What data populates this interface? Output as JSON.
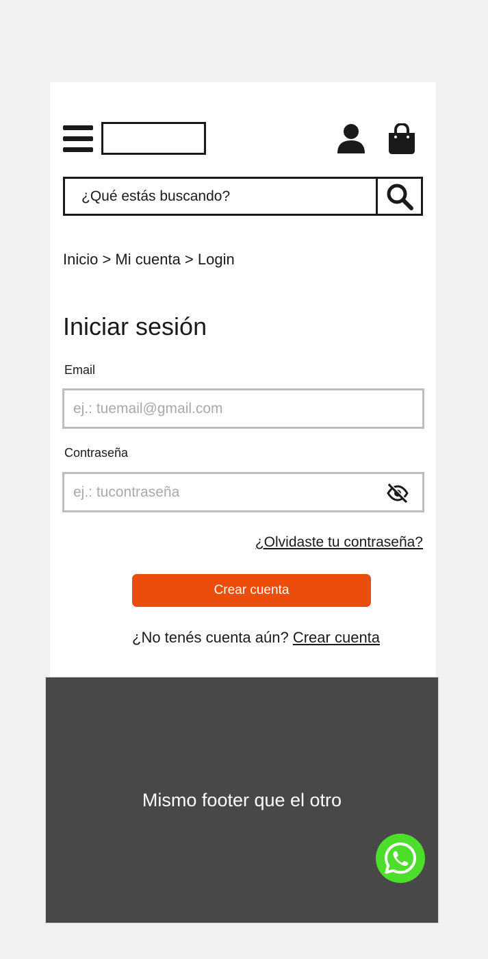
{
  "header": {
    "menu_icon": "hamburger-icon",
    "user_icon": "user-icon",
    "cart_icon": "shopping-bag-icon"
  },
  "search": {
    "placeholder": "¿Qué estás buscando?",
    "icon": "search-icon"
  },
  "breadcrumb": "Inicio > Mi cuenta > Login",
  "login": {
    "title": "Iniciar sesión",
    "email_label": "Email",
    "email_placeholder": "ej.: tuemail@gmail.com",
    "password_label": "Contraseña",
    "password_placeholder": "ej.: tucontraseña",
    "password_toggle_icon": "eye-slash-icon",
    "forgot_link": "¿Olvidaste tu contraseña?",
    "submit_label": "Crear cuenta",
    "no_account_text": "¿No tenés cuenta aún?",
    "signup_link": "Crear cuenta"
  },
  "footer": {
    "text": "Mismo footer que el otro"
  },
  "whatsapp": {
    "icon": "whatsapp-icon"
  },
  "colors": {
    "accent": "#eb4d0b",
    "footer_bg": "#484848",
    "whatsapp": "#4cde2b",
    "page_bg": "#f1f1f1"
  }
}
